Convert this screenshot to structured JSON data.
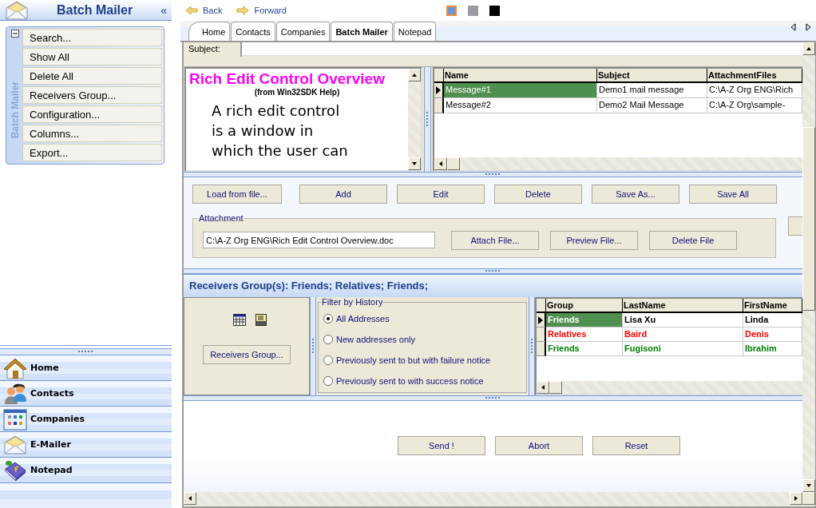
{
  "sidebar": {
    "title": "Batch Mailer",
    "collapse": "«",
    "panel": {
      "label": "Batch Mailer",
      "expanded": true,
      "actions": [
        "Search...",
        "Show All",
        "Delete All",
        "Receivers Group...",
        "Configuration...",
        "Columns...",
        "Export..."
      ]
    },
    "nav": [
      "Home",
      "Contacts",
      "Companies",
      "E-Mailer",
      "Notepad"
    ]
  },
  "toolbar": {
    "back": "Back",
    "forward": "Forward",
    "themes": [
      {
        "color": "#6a96d4",
        "selected": true
      },
      {
        "color": "#9b9ba3",
        "selected": false
      },
      {
        "color": "#000000",
        "selected": false
      }
    ]
  },
  "tabs": [
    {
      "label": "Home",
      "selected": false
    },
    {
      "label": "Contacts",
      "selected": false
    },
    {
      "label": "Companies",
      "selected": false
    },
    {
      "label": "Batch Mailer",
      "selected": true
    },
    {
      "label": "Notepad",
      "selected": false
    }
  ],
  "subject": {
    "label": "Subject:"
  },
  "editor": {
    "title": "Rich Edit Control Overview",
    "subtitle": "(from Win32SDK Help)",
    "lines": [
      "A rich edit control",
      "is a window in",
      "which the user can"
    ]
  },
  "messages": {
    "columns": [
      "Name",
      "Subject",
      "AttachmentFiles"
    ],
    "rows": [
      {
        "cells": [
          "Message#1",
          "Demo1 mail message",
          "C:\\A-Z Org ENG\\Rich"
        ],
        "selected": true
      },
      {
        "cells": [
          "Message#2",
          "Demo2 Mail Message",
          "C:\\A-Z Org\\sample-"
        ],
        "selected": false
      }
    ]
  },
  "message_buttons": [
    "Load from file...",
    "Add",
    "Edit",
    "Delete",
    "Save As...",
    "Save All"
  ],
  "attachment": {
    "legend": "Attachment",
    "path": "C:\\A-Z Org ENG\\Rich Edit Control Overview.doc",
    "buttons": [
      "Attach File...",
      "Preview File...",
      "Delete File"
    ]
  },
  "receivers": {
    "header": "Receivers Group(s): Friends; Relatives; Friends;",
    "button": "Receivers Group...",
    "filter": {
      "legend": "Filter by History",
      "options": [
        {
          "label": "All Addresses",
          "selected": true
        },
        {
          "label": "New addresses only",
          "selected": false
        },
        {
          "label": "Previously sent to but with failure notice",
          "selected": false
        },
        {
          "label": "Previously sent to with success notice",
          "selected": false
        }
      ]
    },
    "grid": {
      "columns": [
        "Group",
        "LastName",
        "FirstName"
      ],
      "rows": [
        {
          "cells": [
            "Friends",
            "Lisa Xu",
            "Linda"
          ],
          "color": "#000000",
          "selected": true
        },
        {
          "cells": [
            "Relatives",
            "Baird",
            "Denis"
          ],
          "color": "#ff0000",
          "selected": false
        },
        {
          "cells": [
            "Friends",
            "Fugisoni",
            "Ibrahim"
          ],
          "color": "#008000",
          "selected": false
        }
      ]
    }
  },
  "send_buttons": [
    "Send !",
    "Abort",
    "Reset"
  ]
}
